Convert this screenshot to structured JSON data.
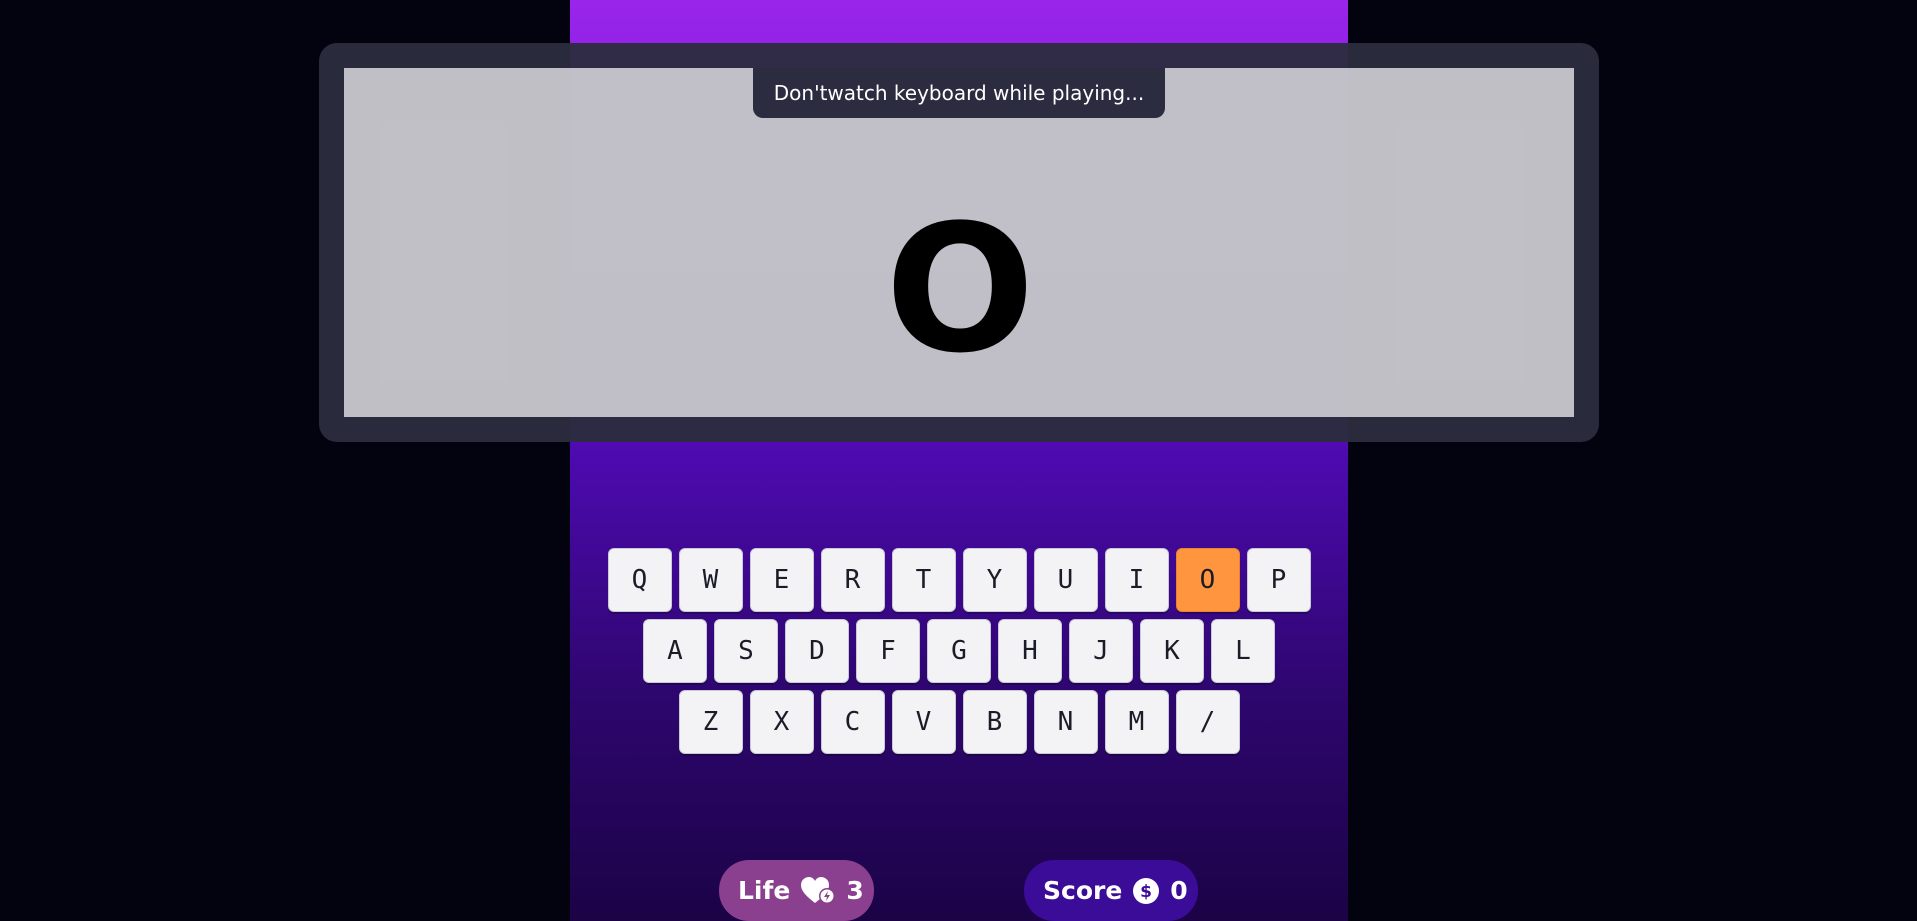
{
  "overlay": {
    "hint": "Don'twatch keyboard while playing...",
    "target_letter": "O"
  },
  "keyboard": {
    "rows": [
      [
        "Q",
        "W",
        "E",
        "R",
        "T",
        "Y",
        "U",
        "I",
        "O",
        "P"
      ],
      [
        "A",
        "S",
        "D",
        "F",
        "G",
        "H",
        "J",
        "K",
        "L"
      ],
      [
        "Z",
        "X",
        "C",
        "V",
        "B",
        "N",
        "M",
        "/"
      ]
    ],
    "highlighted_key": "O"
  },
  "hud": {
    "life_label": "Life",
    "life_value": "3",
    "life_icon": "heart-icon",
    "score_label": "Score",
    "score_value": "0",
    "score_icon": "dollar-coin-icon"
  },
  "colors": {
    "background": "#02030f",
    "game_gradient_top": "#9a24ea",
    "game_gradient_bottom": "#1b0346",
    "key_highlight": "#ff963f",
    "life_pill": "#8b3f8f",
    "score_pill": "#3a0c98"
  }
}
